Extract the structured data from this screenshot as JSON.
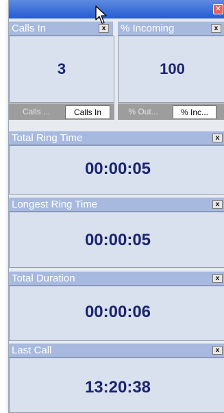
{
  "window": {
    "close_glyph": "✕"
  },
  "panels": {
    "calls_in": {
      "title": "Calls In",
      "close": "x",
      "value": "3",
      "tabs": [
        "Calls ...",
        "Calls In"
      ]
    },
    "pct_incoming": {
      "title": "% Incoming",
      "close": "x",
      "value": "100",
      "tabs": [
        "% Out...",
        "% Inc..."
      ]
    },
    "total_ring": {
      "title": "Total Ring Time",
      "close": "x",
      "value": "00:00:05"
    },
    "longest_ring": {
      "title": "Longest Ring Time",
      "close": "x",
      "value": "00:00:05"
    },
    "total_duration": {
      "title": "Total Duration",
      "close": "x",
      "value": "00:00:06"
    },
    "last_call": {
      "title": "Last Call",
      "close": "x",
      "value": "13:20:38"
    }
  },
  "colors": {
    "title_bar": "#245bd2",
    "panel_header": "#a8b9e0",
    "value_text": "#1b2471",
    "panel_body": "#d9e1ef"
  }
}
